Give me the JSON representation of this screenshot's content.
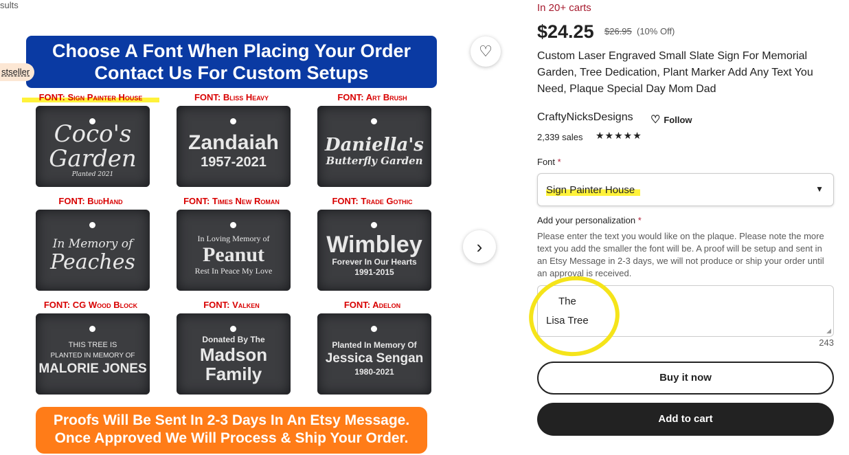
{
  "breadcrumb": "sults",
  "badge": "Bestseller",
  "listing_image": {
    "banner_line1": "Choose A Font When Placing Your Order",
    "banner_line2": "Contact Us For Custom Setups",
    "footer_line1": "Proofs Will Be Sent In 2-3 Days In An Etsy Message.",
    "footer_line2": "Once Approved We Will Process & Ship Your Order.",
    "fonts": [
      {
        "label": "FONT: Sign Painter House",
        "lines": [
          "Coco's",
          "Garden",
          "Planted 2021"
        ]
      },
      {
        "label": "FONT: Bliss Heavy",
        "lines": [
          "Zandaiah",
          "1957-2021"
        ]
      },
      {
        "label": "FONT: Art Brush",
        "lines": [
          "Daniella's",
          "Butterfly Garden"
        ]
      },
      {
        "label": "FONT: BudHand",
        "lines": [
          "In Memory of",
          "Peaches"
        ]
      },
      {
        "label": "FONT: Times New Roman",
        "lines": [
          "In Loving Memory of",
          "Peanut",
          "Rest In Peace My Love"
        ]
      },
      {
        "label": "FONT: Trade Gothic",
        "lines": [
          "Wimbley",
          "Forever In Our Hearts",
          "1991-2015"
        ]
      },
      {
        "label": "FONT: CG Wood Block",
        "lines": [
          "THIS TREE IS",
          "PLANTED IN MEMORY OF",
          "MALORIE JONES"
        ]
      },
      {
        "label": "FONT: Valken",
        "lines": [
          "Donated By The",
          "Madson",
          "Family"
        ]
      },
      {
        "label": "FONT: Adelon",
        "lines": [
          "Planted In Memory Of",
          "Jessica Sengan",
          "1980-2021"
        ]
      }
    ]
  },
  "favorite_icon": "heart-icon",
  "next_icon": "chevron-right-icon",
  "product": {
    "carts": "In 20+ carts",
    "price": "$24.25",
    "original_price": "$26.95",
    "discount": "(10% Off)",
    "title": "Custom Laser Engraved Small Slate Sign For Memorial Garden, Tree Dedication, Plant Marker Add Any Text You Need, Plaque Special Day Mom Dad",
    "shop_name": "CraftyNicksDesigns",
    "follow_label": "Follow",
    "sales": "2,339 sales",
    "rating_stars": "★★★★★"
  },
  "form": {
    "font_label": "Font",
    "font_value": "Sign Painter House",
    "personalization_label": "Add your personalization",
    "personalization_help": "Please enter the text you would like on the plaque. Please note the more text you add the smaller the font will be. A proof will be setup and sent in an Etsy Message in 2-3 days, we will not produce or ship your order until an approval is received.",
    "personalization_line1": "The",
    "personalization_line2": "Lisa Tree",
    "chars_left": "243",
    "required_mark": "*"
  },
  "actions": {
    "buy_now": "Buy it now",
    "add_to_cart": "Add to cart"
  },
  "colors": {
    "carts_red": "#a61a2e",
    "banner_blue": "#0a3aa3",
    "footer_orange": "#ff7c18",
    "highlight_yellow": "#fff23a",
    "button_dark": "#222222"
  }
}
